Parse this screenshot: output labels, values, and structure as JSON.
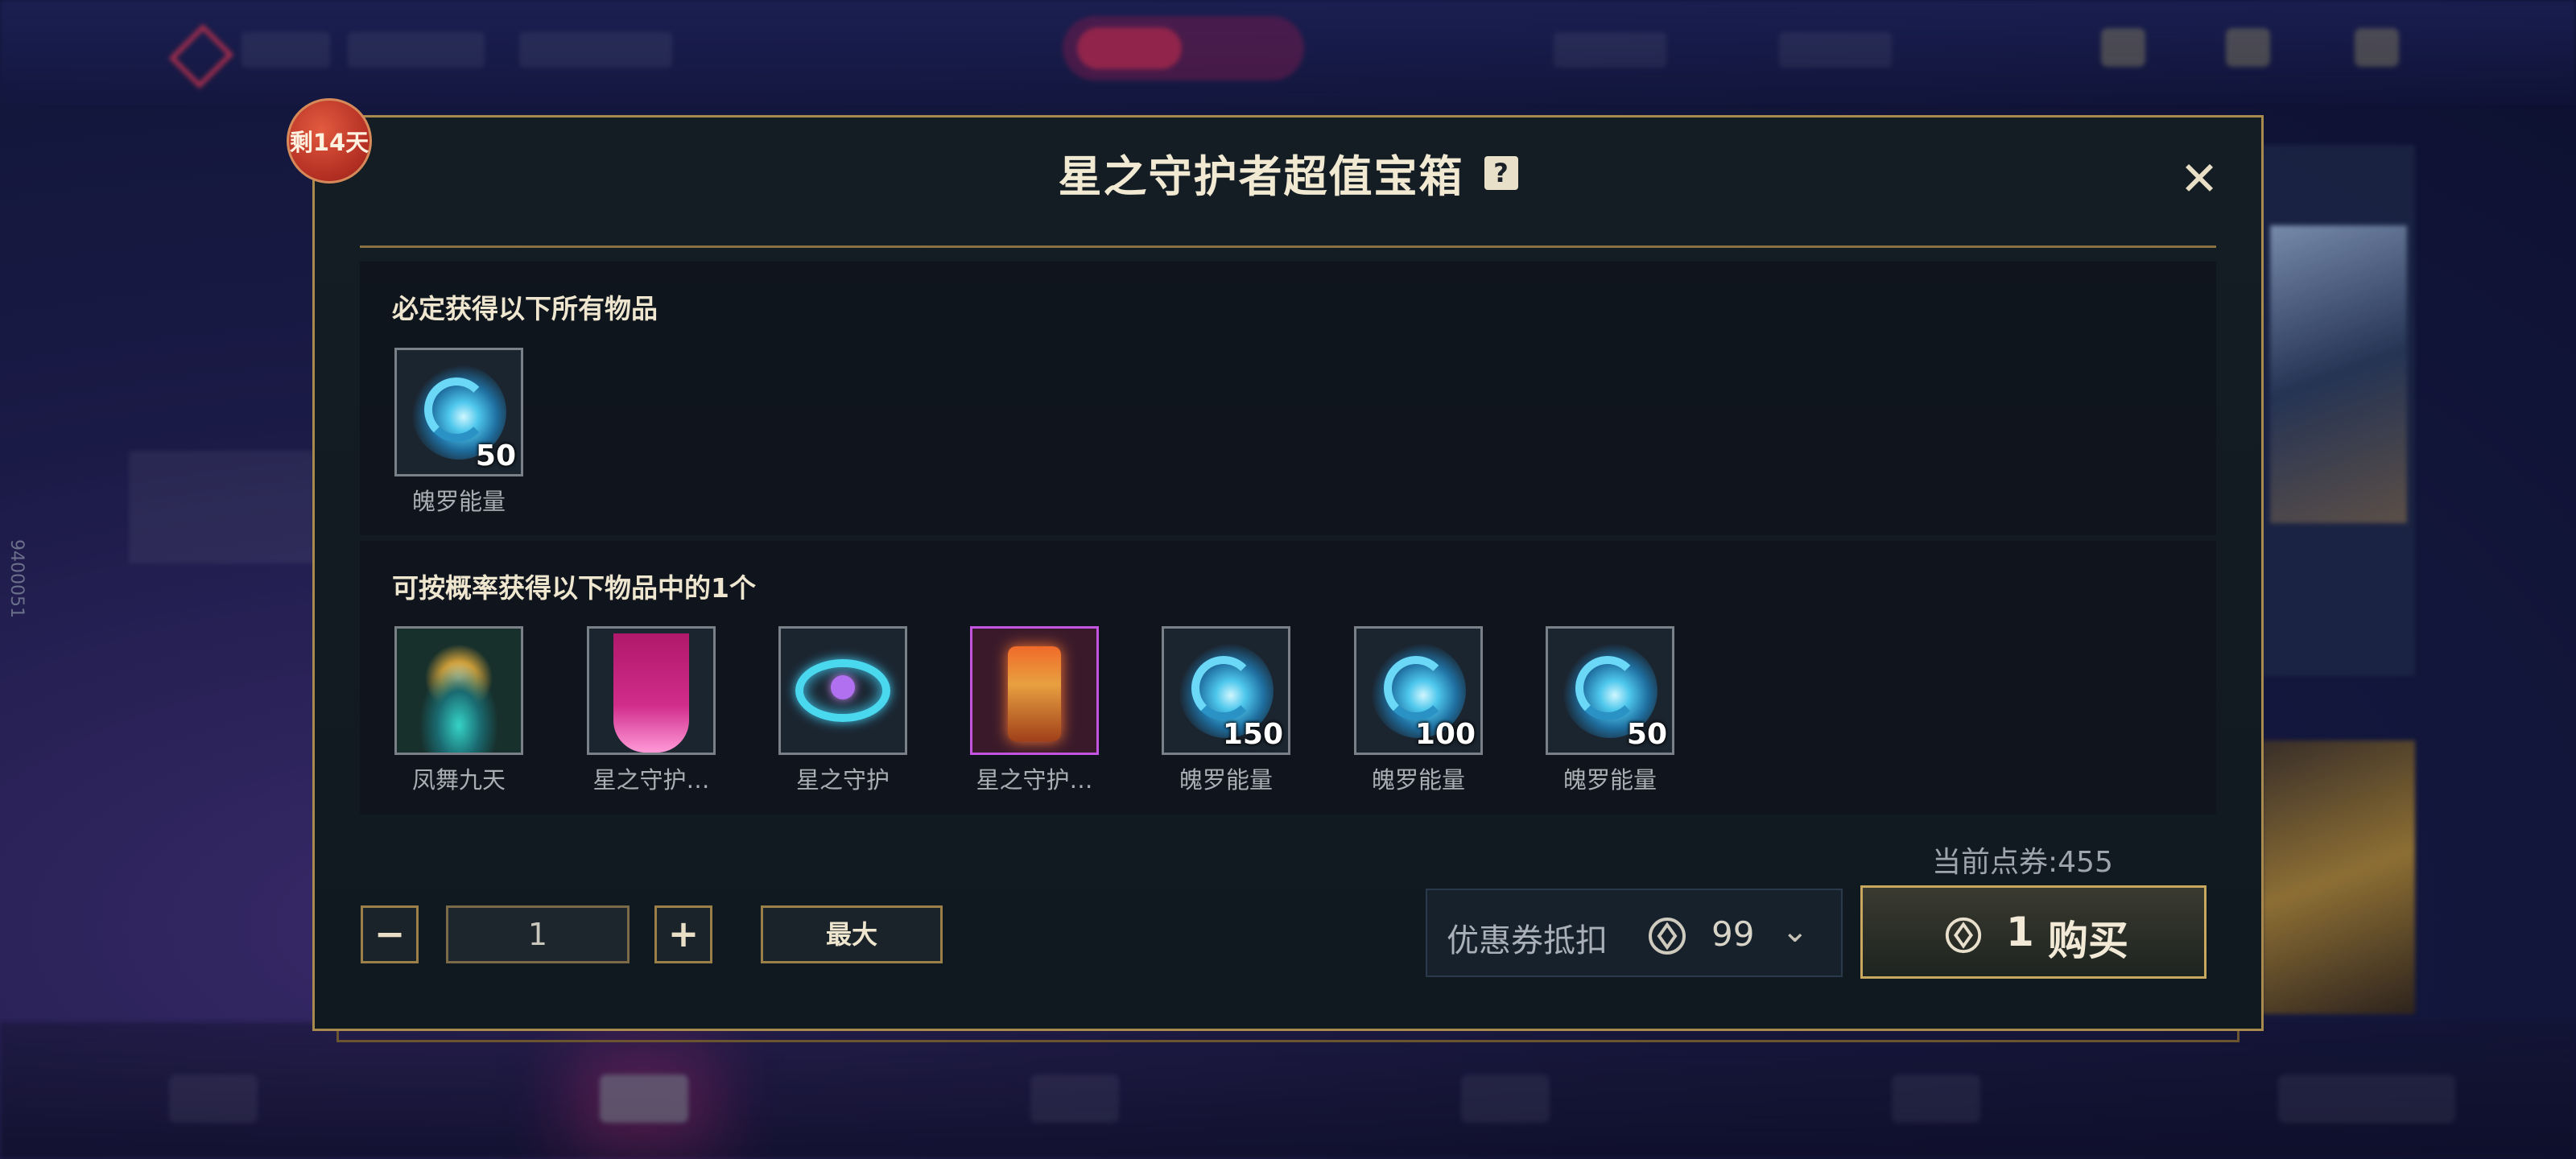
{
  "background": {
    "side_code": "9400051"
  },
  "modal": {
    "days_left_badge": "剩14天",
    "title": "星之守护者超值宝箱",
    "help_icon": "?",
    "close_icon": "✕"
  },
  "guaranteed": {
    "heading": "必定获得以下所有物品",
    "items": [
      {
        "name": "魄罗能量",
        "qty": "50",
        "icon": "poro-energy-icon"
      }
    ]
  },
  "random": {
    "heading": "可按概率获得以下物品中的1个",
    "items": [
      {
        "name": "凤舞九天",
        "qty": "",
        "icon": "phoenix-effect-icon"
      },
      {
        "name": "星之守护…",
        "qty": "",
        "icon": "star-guardian-banner-icon"
      },
      {
        "name": "星之守护",
        "qty": "",
        "icon": "star-guardian-ring-icon"
      },
      {
        "name": "星之守护…",
        "qty": "",
        "icon": "star-guardian-lantern-icon"
      },
      {
        "name": "魄罗能量",
        "qty": "150",
        "icon": "poro-energy-icon"
      },
      {
        "name": "魄罗能量",
        "qty": "100",
        "icon": "poro-energy-icon"
      },
      {
        "name": "魄罗能量",
        "qty": "50",
        "icon": "poro-energy-icon"
      }
    ]
  },
  "controls": {
    "minus": "−",
    "quantity": "1",
    "plus": "+",
    "max_label": "最大",
    "balance": "当前点券:455",
    "coupon_label": "优惠券抵扣",
    "coupon_value": "99",
    "coupon_chevron": "⌄",
    "buy_price": "1",
    "buy_label": "购买"
  },
  "colors": {
    "gold_border": "#a88a4e",
    "badge_red": "#b22e22",
    "rare_purple": "#c455e0",
    "poro_blue": "#4ec7ec"
  }
}
